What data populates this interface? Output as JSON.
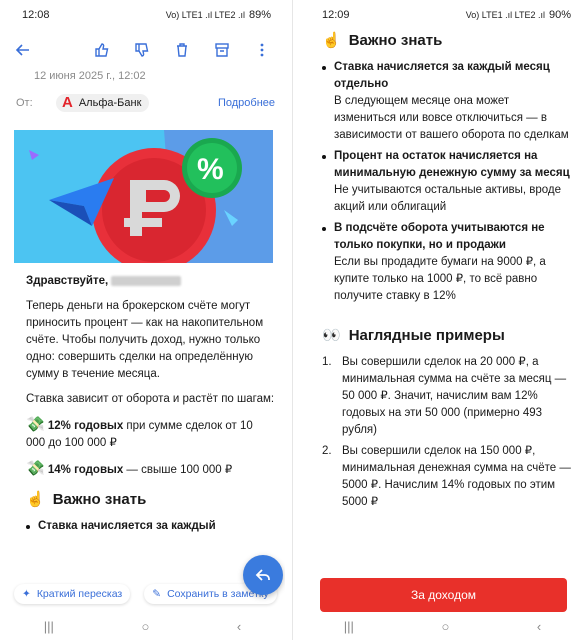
{
  "left": {
    "status": {
      "time": "12:08",
      "net": "Vo) LTE1 .ıl LTE2 .ıl",
      "battery": "89%"
    },
    "date": "12 июня 2025 г., 12:02",
    "from": {
      "label": "От:",
      "sender": "Альфа-Банк",
      "more": "Подробнее"
    },
    "greeting": "Здравствуйте,",
    "p1": "Теперь деньги на брокерском счёте могут приносить процент — как на накопительном счёте. Чтобы получить доход, нужно только одно: совершить сделки на определённую сумму в течение месяца.",
    "p2": "Ставка зависит от оборота и растёт по шагам:",
    "rate1_bold": "12% годовых",
    "rate1_rest": " при сумме сделок от 10 000 до 100 000 ₽",
    "rate2_bold": "14% годовых",
    "rate2_rest": " — свыше 100 000 ₽",
    "section_title": "Важно знать",
    "bullet_preview": "Ставка начисляется за каждый",
    "bottom": {
      "summary": "Краткий пересказ",
      "save": "Сохранить в заметку"
    }
  },
  "right": {
    "status": {
      "time": "12:09",
      "net": "Vo) LTE1 .ıl LTE2 .ıl",
      "battery": "90%"
    },
    "section1_title": "Важно знать",
    "bullets": [
      {
        "title": "Ставка начисляется за каждый месяц отдельно",
        "text": "В следующем месяце она может измениться или вовсе отключиться — в зависимости от вашего оборота по сделкам"
      },
      {
        "title": "Процент на остаток начисляется на минимальную денежную сумму за месяц",
        "text": "Не учитываются остальные активы, вроде акций или облигаций"
      },
      {
        "title": "В подсчёте оборота учитываются не только покупки, но и продажи",
        "text": "Если вы продадите бумаги на 9000 ₽, а купите только на 1000 ₽, то всё равно получите ставку в 12%"
      }
    ],
    "section2_title": "Наглядные примеры",
    "examples": [
      {
        "n": "1.",
        "text": "Вы совершили сделок на 20 000 ₽, а минимальная сумма на счёте за месяц — 50 000 ₽. Значит, начислим вам 12% годовых на эти 50 000 (примерно 493 рубля)"
      },
      {
        "n": "2.",
        "text": "Вы совершили сделок на 150 000 ₽, минимальная денежная сумма на счёте — 5000 ₽. Начислим 14% годовых по этим 5000 ₽"
      }
    ],
    "cta": "За доходом"
  },
  "icons": [
    "back-arrow-icon",
    "like-icon",
    "dislike-icon",
    "trash-icon",
    "archive-icon",
    "more-vert-icon",
    "hand-point-icon",
    "eyes-icon",
    "money-icon",
    "ai-summary-icon",
    "note-icon",
    "reply-icon"
  ]
}
